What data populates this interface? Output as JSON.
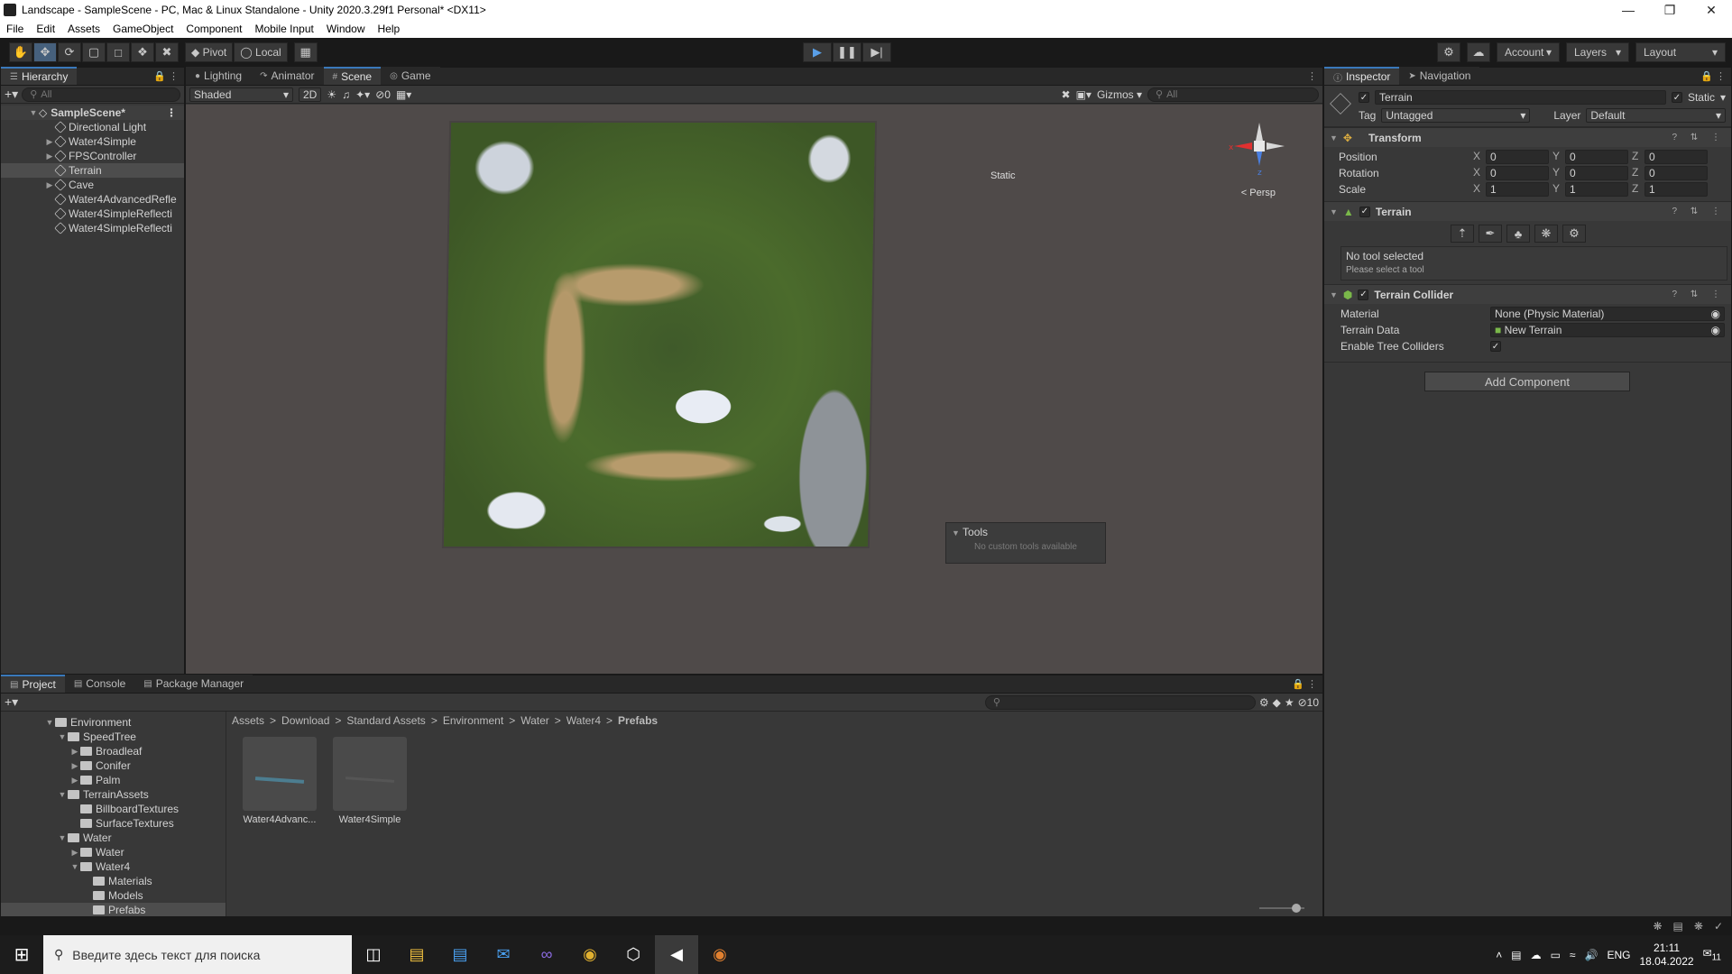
{
  "window": {
    "title": "Landscape - SampleScene - PC, Mac & Linux Standalone - Unity 2020.3.29f1 Personal* <DX11>"
  },
  "menu": [
    "File",
    "Edit",
    "Assets",
    "GameObject",
    "Component",
    "Mobile Input",
    "Window",
    "Help"
  ],
  "toolbar": {
    "pivot": "Pivot",
    "local": "Local",
    "account": "Account",
    "layers": "Layers",
    "layout": "Layout"
  },
  "hierarchy": {
    "tab": "Hierarchy",
    "search_placeholder": "All",
    "scene": "SampleScene*",
    "items": [
      {
        "label": "Directional Light",
        "expandable": false
      },
      {
        "label": "Water4Simple",
        "expandable": true
      },
      {
        "label": "FPSController",
        "expandable": true
      },
      {
        "label": "Terrain",
        "expandable": false,
        "selected": true
      },
      {
        "label": "Cave",
        "expandable": true
      },
      {
        "label": "Water4AdvancedRefle",
        "expandable": false
      },
      {
        "label": "Water4SimpleReflecti",
        "expandable": false
      },
      {
        "label": "Water4SimpleReflecti",
        "expandable": false
      }
    ]
  },
  "scene": {
    "tabs": [
      "Lighting",
      "Animator",
      "Scene",
      "Game"
    ],
    "active_tab": "Scene",
    "shading": "Shaded",
    "mode_2d": "2D",
    "hidden_count": "0",
    "gizmos": "Gizmos",
    "search_placeholder": "All",
    "static_label": "Static",
    "persp": "< Persp",
    "axis_x": "x",
    "axis_z": "z",
    "tools_title": "Tools",
    "tools_sub": "No custom tools available"
  },
  "inspector": {
    "tabs": [
      "Inspector",
      "Navigation"
    ],
    "object_name": "Terrain",
    "static": "Static",
    "tag_label": "Tag",
    "tag_value": "Untagged",
    "layer_label": "Layer",
    "layer_value": "Default",
    "transform": {
      "title": "Transform",
      "rows": [
        {
          "label": "Position",
          "x": "0",
          "y": "0",
          "z": "0"
        },
        {
          "label": "Rotation",
          "x": "0",
          "y": "0",
          "z": "0"
        },
        {
          "label": "Scale",
          "x": "1",
          "y": "1",
          "z": "1"
        }
      ]
    },
    "terrain": {
      "title": "Terrain",
      "no_tool": "No tool selected",
      "select_tool": "Please select a tool"
    },
    "collider": {
      "title": "Terrain Collider",
      "material_label": "Material",
      "material_value": "None (Physic Material)",
      "data_label": "Terrain Data",
      "data_value": "New Terrain",
      "trees_label": "Enable Tree Colliders"
    },
    "add_component": "Add Component"
  },
  "project": {
    "tabs": [
      "Project",
      "Console",
      "Package Manager"
    ],
    "hidden_count": "10",
    "breadcrumb": [
      "Assets",
      "Download",
      "Standard Assets",
      "Environment",
      "Water",
      "Water4",
      "Prefabs"
    ],
    "tree": [
      {
        "label": "Environment",
        "depth": 0,
        "arrow": "▼"
      },
      {
        "label": "SpeedTree",
        "depth": 1,
        "arrow": "▼"
      },
      {
        "label": "Broadleaf",
        "depth": 2,
        "arrow": "▶"
      },
      {
        "label": "Conifer",
        "depth": 2,
        "arrow": "▶"
      },
      {
        "label": "Palm",
        "depth": 2,
        "arrow": "▶"
      },
      {
        "label": "TerrainAssets",
        "depth": 1,
        "arrow": "▼"
      },
      {
        "label": "BillboardTextures",
        "depth": 2,
        "arrow": ""
      },
      {
        "label": "SurfaceTextures",
        "depth": 2,
        "arrow": ""
      },
      {
        "label": "Water",
        "depth": 1,
        "arrow": "▼"
      },
      {
        "label": "Water",
        "depth": 2,
        "arrow": "▶"
      },
      {
        "label": "Water4",
        "depth": 2,
        "arrow": "▼"
      },
      {
        "label": "Materials",
        "depth": 3,
        "arrow": ""
      },
      {
        "label": "Models",
        "depth": 3,
        "arrow": ""
      },
      {
        "label": "Prefabs",
        "depth": 3,
        "arrow": "",
        "selected": true
      }
    ],
    "assets": [
      "Water4Advanc...",
      "Water4Simple"
    ]
  },
  "taskbar": {
    "search_placeholder": "Введите здесь текст для поиска",
    "lang": "ENG",
    "time": "21:11",
    "date": "18.04.2022",
    "notif_count": "11"
  }
}
